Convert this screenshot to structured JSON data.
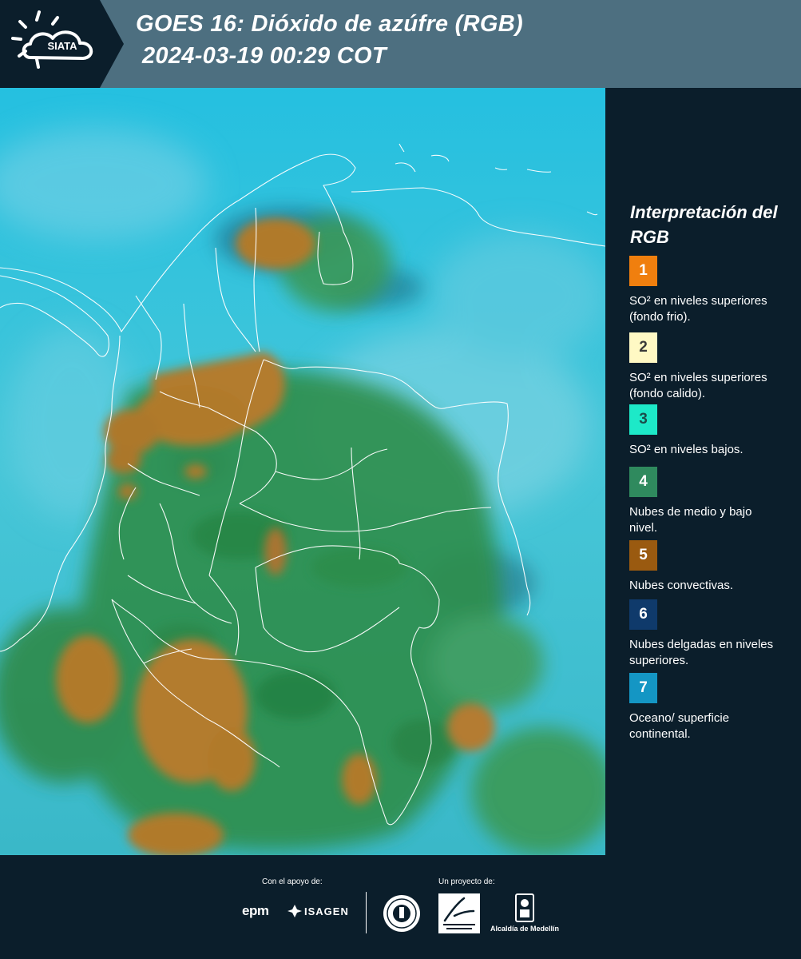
{
  "header": {
    "logo_text": "SIATA",
    "title_line1": "GOES 16: Dióxido de azúfre (RGB)",
    "title_line2": "2024-03-19 00:29 COT"
  },
  "legend": {
    "title": "Interpretación del RGB",
    "items": [
      {
        "number": "1",
        "text": "SO² en niveles superiores (fondo frio).",
        "color": "#f07f0e",
        "text_color": "#ffffff"
      },
      {
        "number": "2",
        "text": "SO² en niveles superiores (fondo calido).",
        "color": "#fff9c4",
        "text_color": "#3a3a3a"
      },
      {
        "number": "3",
        "text": "SO² en niveles bajos.",
        "color": "#1de9c8",
        "text_color": "#1b4d4a"
      },
      {
        "number": "4",
        "text": "Nubes de medio y bajo nivel.",
        "color": "#2f8a5e",
        "text_color": "#ffffff"
      },
      {
        "number": "5",
        "text": "Nubes convectivas.",
        "color": "#9a5a10",
        "text_color": "#ffffff"
      },
      {
        "number": "6",
        "text": "Nubes delgadas en niveles superiores.",
        "color": "#0f3a6b",
        "text_color": "#ffffff"
      },
      {
        "number": "7",
        "text": "Oceano/ superficie continental.",
        "color": "#1496c4",
        "text_color": "#ffffff"
      }
    ]
  },
  "footer": {
    "support_label": "Con el apoyo de:",
    "project_label": "Un proyecto de:",
    "epm": "epm",
    "isagen": "ISAGEN",
    "alcaldia": "Alcaldía de Medellín"
  },
  "colors": {
    "header_bg": "#4d6f80",
    "panel_bg": "#0b1e2b",
    "ocean": "#3cc8dc",
    "convective": "#b07a2c",
    "vegetation": "#2e8a4a"
  }
}
